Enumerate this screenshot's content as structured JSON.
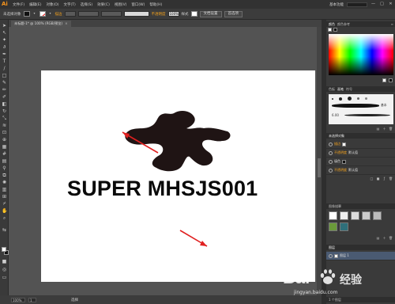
{
  "app": {
    "logo": "Ai",
    "menus": [
      "文件(F)",
      "编辑(E)",
      "对象(O)",
      "文字(T)",
      "选择(S)",
      "效果(C)",
      "视图(V)",
      "窗口(W)",
      "帮助(H)"
    ],
    "workspace": "基本功能",
    "window_buttons": [
      "—",
      "□",
      "✕"
    ]
  },
  "control_bar": {
    "selection_label": "未选择对象",
    "stroke_label": "描边",
    "style_label": "样式",
    "opacity_label": "不透明度",
    "opacity_value": "100%",
    "document_setup": "文档设置",
    "preferences": "首选项"
  },
  "document_tab": {
    "title": "未标题-1* @ 100% (RGB/预览)",
    "close": "×"
  },
  "canvas": {
    "brand_text": "SUPER MHSJS001",
    "arrow_color": "#e02020"
  },
  "statusbar": {
    "zoom": "100%",
    "page": "1",
    "status_text": "选择"
  },
  "panels": {
    "color_tabs": [
      "颜色",
      "颜色参考"
    ],
    "brush_tabs": [
      "色板",
      "画笔",
      "符号"
    ],
    "brush_label": "基本",
    "brush_size": "6.00",
    "appearance_title": "未选择对象",
    "appearance_rows": [
      {
        "label": "描边",
        "value": ""
      },
      {
        "label": "不透明度",
        "value": "默认值"
      },
      {
        "label": "填色",
        "value": ""
      },
      {
        "label": "不透明度",
        "value": "默认值"
      }
    ],
    "image_trace_tabs": [
      "图像描摹",
      "图层"
    ],
    "layer_name": "图层 1",
    "layer_count": "1 个图层"
  },
  "watermark": {
    "brand_left": "Bai",
    "brand_right": "经验",
    "url": "jingyan.baidu.com"
  },
  "colors": {
    "accent_orange": "#f4a21d",
    "ui_dark": "#323232",
    "canvas_bg": "#535353"
  }
}
